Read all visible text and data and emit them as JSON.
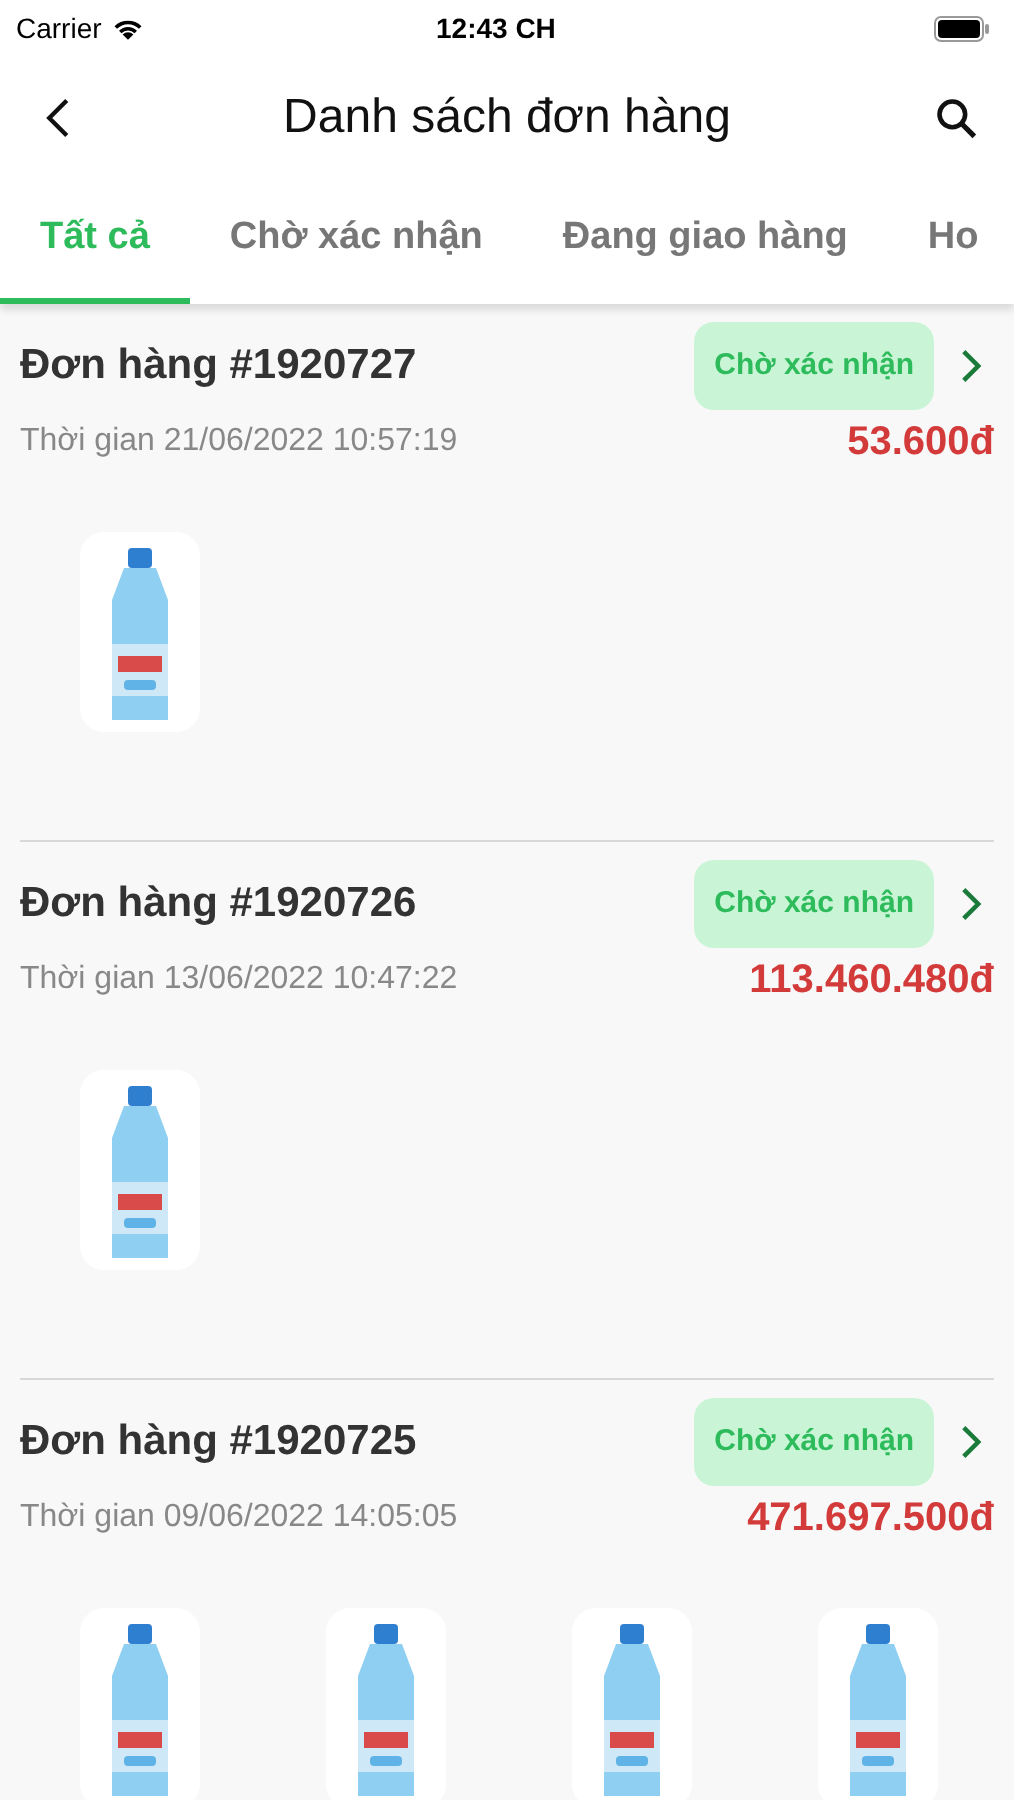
{
  "status_bar": {
    "carrier": "Carrier",
    "time": "12:43 CH"
  },
  "header": {
    "title": "Danh sách đơn hàng"
  },
  "tabs": [
    {
      "label": "Tất cả",
      "selected": true
    },
    {
      "label": "Chờ xác nhận",
      "selected": false
    },
    {
      "label": "Đang giao hàng",
      "selected": false
    },
    {
      "label": "Ho",
      "selected": false
    }
  ],
  "orders": [
    {
      "title": "Đơn hàng #1920727",
      "status": "Chờ xác nhận",
      "time": "Thời gian 21/06/2022 10:57:19",
      "total": "53.600đ"
    },
    {
      "title": "Đơn hàng #1920726",
      "status": "Chờ xác nhận",
      "time": "Thời gian 13/06/2022 10:47:22",
      "total": "113.460.480đ"
    },
    {
      "title": "Đơn hàng #1920725",
      "status": "Chờ xác nhận",
      "time": "Thời gian 09/06/2022 14:05:05",
      "total": "471.697.500đ"
    }
  ]
}
